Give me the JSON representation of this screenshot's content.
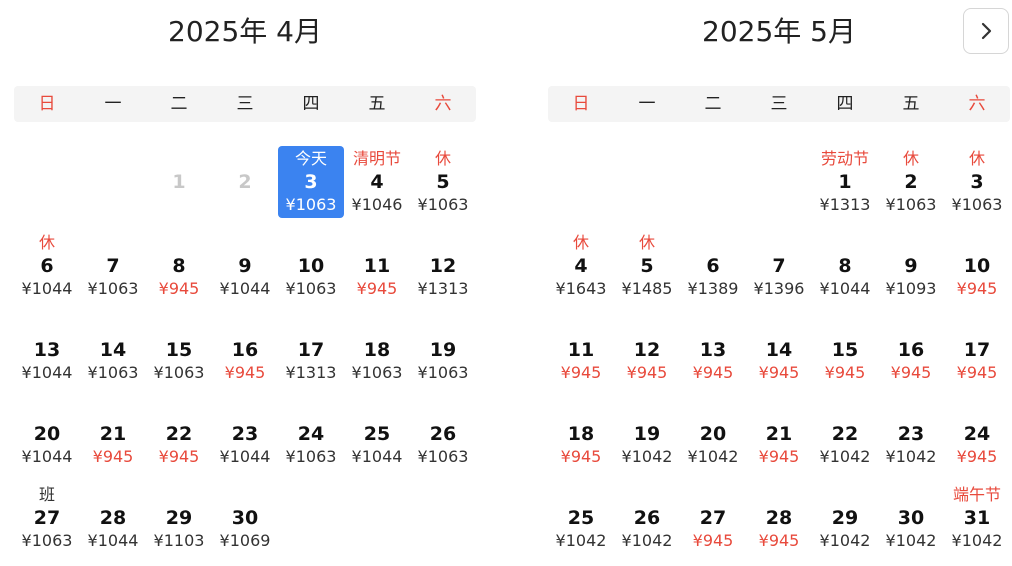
{
  "nav": {
    "next_icon": "chevron-right-icon"
  },
  "weekdays": [
    "日",
    "一",
    "二",
    "三",
    "四",
    "五",
    "六"
  ],
  "months": [
    {
      "title": "2025年 4月",
      "lead_blanks": 2,
      "days": [
        {
          "day": "1",
          "past": true
        },
        {
          "day": "2",
          "past": true
        },
        {
          "day": "3",
          "tag": "今天",
          "price": "¥1063",
          "today": true
        },
        {
          "day": "4",
          "tag": "清明节",
          "price": "¥1046"
        },
        {
          "day": "5",
          "tag": "休",
          "price": "¥1063"
        },
        {
          "day": "6",
          "tag": "休",
          "price": "¥1044"
        },
        {
          "day": "7",
          "price": "¥1063"
        },
        {
          "day": "8",
          "price": "¥945",
          "low": true
        },
        {
          "day": "9",
          "price": "¥1044"
        },
        {
          "day": "10",
          "price": "¥1063"
        },
        {
          "day": "11",
          "price": "¥945",
          "low": true
        },
        {
          "day": "12",
          "price": "¥1313"
        },
        {
          "day": "13",
          "price": "¥1044"
        },
        {
          "day": "14",
          "price": "¥1063"
        },
        {
          "day": "15",
          "price": "¥1063"
        },
        {
          "day": "16",
          "price": "¥945",
          "low": true
        },
        {
          "day": "17",
          "price": "¥1313"
        },
        {
          "day": "18",
          "price": "¥1063"
        },
        {
          "day": "19",
          "price": "¥1063"
        },
        {
          "day": "20",
          "price": "¥1044"
        },
        {
          "day": "21",
          "price": "¥945",
          "low": true
        },
        {
          "day": "22",
          "price": "¥945",
          "low": true
        },
        {
          "day": "23",
          "price": "¥1044"
        },
        {
          "day": "24",
          "price": "¥1063"
        },
        {
          "day": "25",
          "price": "¥1044"
        },
        {
          "day": "26",
          "price": "¥1063"
        },
        {
          "day": "27",
          "tag": "班",
          "work": true,
          "price": "¥1063"
        },
        {
          "day": "28",
          "price": "¥1044"
        },
        {
          "day": "29",
          "price": "¥1103"
        },
        {
          "day": "30",
          "price": "¥1069"
        }
      ]
    },
    {
      "title": "2025年 5月",
      "lead_blanks": 4,
      "days": [
        {
          "day": "1",
          "tag": "劳动节",
          "price": "¥1313"
        },
        {
          "day": "2",
          "tag": "休",
          "price": "¥1063"
        },
        {
          "day": "3",
          "tag": "休",
          "price": "¥1063"
        },
        {
          "day": "4",
          "tag": "休",
          "price": "¥1643"
        },
        {
          "day": "5",
          "tag": "休",
          "price": "¥1485"
        },
        {
          "day": "6",
          "price": "¥1389"
        },
        {
          "day": "7",
          "price": "¥1396"
        },
        {
          "day": "8",
          "price": "¥1044"
        },
        {
          "day": "9",
          "price": "¥1093"
        },
        {
          "day": "10",
          "price": "¥945",
          "low": true
        },
        {
          "day": "11",
          "price": "¥945",
          "low": true
        },
        {
          "day": "12",
          "price": "¥945",
          "low": true
        },
        {
          "day": "13",
          "price": "¥945",
          "low": true
        },
        {
          "day": "14",
          "price": "¥945",
          "low": true
        },
        {
          "day": "15",
          "price": "¥945",
          "low": true
        },
        {
          "day": "16",
          "price": "¥945",
          "low": true
        },
        {
          "day": "17",
          "price": "¥945",
          "low": true
        },
        {
          "day": "18",
          "price": "¥945",
          "low": true
        },
        {
          "day": "19",
          "price": "¥1042"
        },
        {
          "day": "20",
          "price": "¥1042"
        },
        {
          "day": "21",
          "price": "¥945",
          "low": true
        },
        {
          "day": "22",
          "price": "¥1042"
        },
        {
          "day": "23",
          "price": "¥1042"
        },
        {
          "day": "24",
          "price": "¥945",
          "low": true
        },
        {
          "day": "25",
          "price": "¥1042"
        },
        {
          "day": "26",
          "price": "¥1042"
        },
        {
          "day": "27",
          "price": "¥945",
          "low": true
        },
        {
          "day": "28",
          "price": "¥945",
          "low": true
        },
        {
          "day": "29",
          "price": "¥1042"
        },
        {
          "day": "30",
          "price": "¥1042"
        },
        {
          "day": "31",
          "tag": "端午节",
          "price": "¥1042"
        }
      ]
    }
  ]
}
